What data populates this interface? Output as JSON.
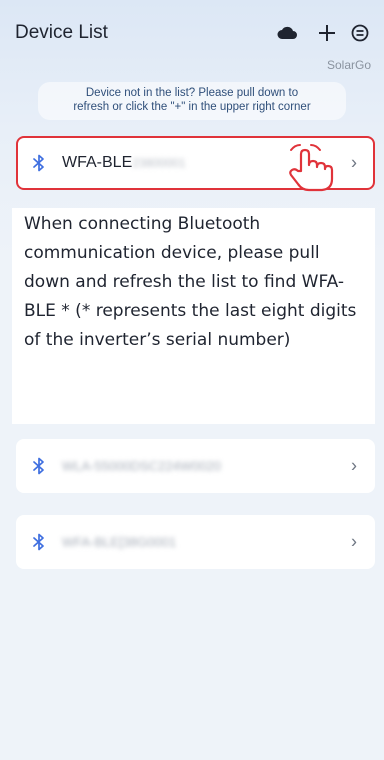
{
  "header": {
    "title": "Device List",
    "brand": "SolarGo",
    "icons": [
      "cloud-icon",
      "plus-icon",
      "menu-icon"
    ]
  },
  "hint": {
    "line1": "Device not in the list? Please pull down to",
    "line2": "refresh or click the \"+\" in the upper right corner"
  },
  "devices": [
    {
      "name": "WFA-BLE",
      "serial_blurred": "23800001",
      "icon": "bluetooth-icon",
      "highlighted": true
    },
    {
      "name": "WLA-55000DSC224W0020",
      "icon": "bluetooth-icon",
      "blurred": true
    },
    {
      "name": "WFA-BLE[38G0001",
      "icon": "bluetooth-icon",
      "blurred": true
    }
  ],
  "tooltip": {
    "text": " When connecting Bluetooth communication device, please pull down and refresh the list to find WFA-BLE * (* represents the last eight digits of the inverter’s serial number)"
  },
  "colors": {
    "accent_blue": "#3f6fe0",
    "highlight_red": "#e0333a",
    "background": "#eef3f9"
  }
}
